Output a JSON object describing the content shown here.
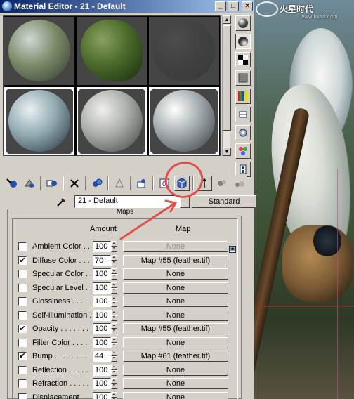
{
  "window": {
    "title": "Material Editor - 21 - Default",
    "buttons": [
      "_",
      "□",
      "×"
    ]
  },
  "slots": [
    {
      "material": "rocky moss",
      "colors": [
        "#cfd8d2",
        "#7c8a6a",
        "#2e3a2a"
      ],
      "active": false
    },
    {
      "material": "moss clump",
      "colors": [
        "#8aa060",
        "#4a6a2a",
        "#1a2a10"
      ],
      "active": false
    },
    {
      "material": "dark fur",
      "colors": [
        "#5a5a5a",
        "#3a3a3a",
        "#202020"
      ],
      "active": false
    },
    {
      "material": "blue-grey",
      "colors": [
        "#e8f0f2",
        "#90a8b0",
        "#1e2e36"
      ],
      "active": true
    },
    {
      "material": "grey plaster",
      "colors": [
        "#f0f0ec",
        "#a8aca6",
        "#3a3e3a"
      ],
      "active": true
    },
    {
      "material": "feather",
      "colors": [
        "#ffffff",
        "#a0a8ac",
        "#303638"
      ],
      "active": true
    }
  ],
  "side_toolbar_icons": [
    "sample-sphere-icon",
    "backlight-icon",
    "checker-background-icon",
    "uv-tiling-icon",
    "video-color-check-icon",
    "make-preview-icon",
    "options-icon",
    "select-by-material-icon",
    "material-navigator-icon"
  ],
  "bottom_toolbar_icons": [
    "get-material-icon",
    "put-to-scene-icon",
    "assign-to-selection-icon",
    "reset-map-icon",
    "make-unique-icon",
    "put-to-library-icon",
    "material-effects-channel-icon",
    "show-map-in-viewport-icon",
    "show-end-result-icon",
    "go-to-parent-icon",
    "go-forward-icon"
  ],
  "material": {
    "name": "21 - Default",
    "type": "Standard"
  },
  "maps": {
    "title": "Maps",
    "col_amount": "Amount",
    "col_map": "Map",
    "rows": [
      {
        "label": "Ambient Color . . .",
        "checked": false,
        "amount": "100",
        "map": "None",
        "disabled": true
      },
      {
        "label": "Diffuse Color . . .",
        "checked": true,
        "amount": "70",
        "map": "Map #55 (feather.tif)",
        "disabled": false
      },
      {
        "label": "Specular Color . .",
        "checked": false,
        "amount": "100",
        "map": "None",
        "disabled": false
      },
      {
        "label": "Specular Level . .",
        "checked": false,
        "amount": "100",
        "map": "None",
        "disabled": false
      },
      {
        "label": "Glossiness . . . . .",
        "checked": false,
        "amount": "100",
        "map": "None",
        "disabled": false
      },
      {
        "label": "Self-Illumination .",
        "checked": false,
        "amount": "100",
        "map": "None",
        "disabled": false
      },
      {
        "label": "Opacity . . . . . . .",
        "checked": true,
        "amount": "100",
        "map": "Map #55 (feather.tif)",
        "disabled": false
      },
      {
        "label": "Filter Color . . . .",
        "checked": false,
        "amount": "100",
        "map": "None",
        "disabled": false
      },
      {
        "label": "Bump . . . . . . . .",
        "checked": true,
        "amount": "44",
        "map": "Map #61 (feather.tif)",
        "disabled": false
      },
      {
        "label": "Reflection . . . . .",
        "checked": false,
        "amount": "100",
        "map": "None",
        "disabled": false
      },
      {
        "label": "Refraction . . . . .",
        "checked": false,
        "amount": "100",
        "map": "None",
        "disabled": false
      },
      {
        "label": "Displacement . . .",
        "checked": false,
        "amount": "100",
        "map": "None",
        "disabled": false
      }
    ]
  },
  "watermark": {
    "text": "火星时代",
    "url": "www.hxsd.com"
  },
  "colors": {
    "titlebar_start": "#0a246a",
    "titlebar_end": "#a6caf0",
    "panel": "#d4d0c8",
    "annotation": "#e0504a"
  }
}
